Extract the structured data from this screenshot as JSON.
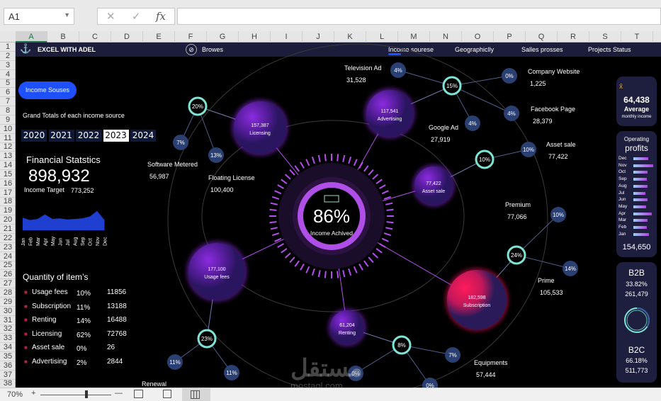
{
  "excel": {
    "cell_ref": "A1",
    "fx_label": "fx",
    "cancel": "✕",
    "confirm": "✓",
    "zoom": "70%",
    "columns": [
      "A",
      "B",
      "C",
      "D",
      "E",
      "F",
      "G",
      "H",
      "I",
      "J",
      "K",
      "L",
      "M",
      "N",
      "O",
      "P",
      "Q",
      "R",
      "S",
      "T"
    ],
    "rows": [
      1,
      2,
      3,
      4,
      5,
      6,
      7,
      8,
      9,
      10,
      11,
      12,
      13,
      14,
      15,
      16,
      17,
      18,
      19,
      20,
      21,
      22,
      23,
      24,
      25,
      26,
      27,
      28,
      29,
      30,
      31,
      32,
      33,
      34,
      35,
      36,
      37,
      38
    ]
  },
  "topbar": {
    "brand": "EXCEL WITH ADEL",
    "browse": "Browes",
    "nav": [
      "Income sourese",
      "Geographiclly",
      "Salles prosses",
      "Projects Status"
    ],
    "active": 0
  },
  "left": {
    "button": "Income Souses",
    "subtitle": "Grand Totals of each income source",
    "years": [
      "2020",
      "2021",
      "2022",
      "2023",
      "2024"
    ],
    "selected_year": "2023",
    "fin_title": "Financial Statstics",
    "fin_total": "898,932",
    "target_label": "Income Target",
    "target_value": "773,252",
    "months": [
      "Jan",
      "Feb",
      "Mar",
      "Apr",
      "May",
      "Jun",
      "Jul",
      "Aug",
      "Sep",
      "Oct",
      "Nov",
      "Dec"
    ],
    "sparkline": [
      62,
      58,
      60,
      68,
      60,
      61,
      59,
      60,
      61,
      64,
      74,
      58
    ],
    "qty_title": "Quantity of item’s",
    "qty": [
      {
        "name": "Usage fees",
        "pct": "10%",
        "count": "11856"
      },
      {
        "name": "Subscription",
        "pct": "11%",
        "count": "13188"
      },
      {
        "name": "Renting",
        "pct": "14%",
        "count": "16488"
      },
      {
        "name": "Licensing",
        "pct": "62%",
        "count": "72768"
      },
      {
        "name": "Asset sale",
        "pct": "0%",
        "count": "26"
      },
      {
        "name": "Advertising",
        "pct": "2%",
        "count": "2844"
      }
    ]
  },
  "center": {
    "percent": "86%",
    "label": "Income Achived",
    "value": 0.86
  },
  "bubbles": [
    {
      "value": "157,387",
      "label": "Licensing"
    },
    {
      "value": "117,541",
      "label": "Advertising"
    },
    {
      "value": "77,422",
      "label": "Asset sale"
    },
    {
      "value": "177,100",
      "label": "Usage fees"
    },
    {
      "value": "61,204",
      "label": "Renting"
    },
    {
      "value": "182,598",
      "label": "Subscription"
    }
  ],
  "rings": [
    "20%",
    "15%",
    "10%",
    "24%",
    "23%",
    "8%"
  ],
  "dots": [
    "7%",
    "13%",
    "4%",
    "0%",
    "4%",
    "4%",
    "10%",
    "10%",
    "14%",
    "11%",
    "11%",
    "7%",
    "0%",
    "0%"
  ],
  "sources": [
    {
      "name": "Television Ad",
      "value": "31,528"
    },
    {
      "name": "Company Website",
      "value": "1,225"
    },
    {
      "name": "Facebook Page",
      "value": "28,379"
    },
    {
      "name": "Google Ad",
      "value": "27,919"
    },
    {
      "name": "Asset sale",
      "value": "77,422"
    },
    {
      "name": "Software Metered",
      "value": "56,987"
    },
    {
      "name": "Floating License",
      "value": "100,400"
    },
    {
      "name": "Premium",
      "value": "77,066"
    },
    {
      "name": "Prime",
      "value": "105,533"
    },
    {
      "name": "Equipments",
      "value": "57,444"
    },
    {
      "name": "Renewal",
      "value": ""
    }
  ],
  "right": {
    "avg_value": "64,438",
    "avg_label": "Average",
    "avg_sub": "monthly income",
    "currency_icon": "x̄",
    "op_title1": "Operating",
    "op_title2": "profits",
    "op_months": [
      "Dec",
      "Nov",
      "Oct",
      "Sep",
      "Aug",
      "Jul",
      "Jun",
      "May",
      "Apr",
      "Mar",
      "Feb",
      "Jan"
    ],
    "op_bars": [
      0.75,
      1.0,
      0.72,
      0.68,
      0.72,
      0.6,
      0.72,
      0.65,
      0.92,
      0.7,
      0.68,
      0.8
    ],
    "op_total": "154,650",
    "b2b": "B2B",
    "b2b_pct": "33.82%",
    "b2b_val": "261,479",
    "b2c": "B2C",
    "b2c_pct": "66.18%",
    "b2c_val": "511,773",
    "b2b_share": 0.3382
  },
  "watermark": {
    "ar": "مستقل",
    "en": "mostaql.com"
  },
  "colors": {
    "navy": "#1c1d3a",
    "accent": "#1e50ff",
    "teal": "#7fe3d6",
    "purple": "#8a2be2",
    "pink": "#e8195a",
    "dot": "#2a3f72"
  }
}
